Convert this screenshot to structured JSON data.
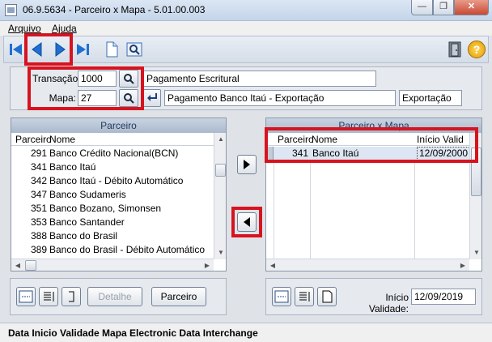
{
  "window": {
    "title": "06.9.5634 - Parceiro x Mapa - 5.01.00.003",
    "minimize_label": "—",
    "maximize_label": "❐",
    "close_label": "✕"
  },
  "menu": {
    "items": [
      "Arquivo",
      "Ajuda"
    ]
  },
  "toolbar": {
    "icons": [
      "first-record-icon",
      "previous-record-icon",
      "next-record-icon",
      "last-record-icon",
      "new-document-icon",
      "search-screen-icon",
      "exit-door-icon",
      "help-icon"
    ],
    "help_label": "?"
  },
  "form": {
    "transacao": {
      "label": "Transação:",
      "code": "1000",
      "description": "Pagamento Escritural"
    },
    "mapa": {
      "label": "Mapa:",
      "code": "27",
      "description": "Pagamento Banco Itaú - Exportação",
      "type": "Exportação"
    }
  },
  "left_grid": {
    "title": "Parceiro",
    "columns": [
      "Parceiro",
      "Nome"
    ],
    "rows": [
      {
        "code": "291",
        "name": "Banco Crédito Nacional(BCN)"
      },
      {
        "code": "341",
        "name": "Banco Itaú"
      },
      {
        "code": "342",
        "name": "Banco Itaú - Débito Automático"
      },
      {
        "code": "347",
        "name": "Banco Sudameris"
      },
      {
        "code": "351",
        "name": "Banco Bozano, Simonsen"
      },
      {
        "code": "353",
        "name": "Banco Santander"
      },
      {
        "code": "388",
        "name": "Banco do Brasil"
      },
      {
        "code": "389",
        "name": "Banco do Brasil - Débito Automático"
      }
    ]
  },
  "right_grid": {
    "title": "Parceiro x Mapa",
    "columns": [
      "Parceiro",
      "Nome",
      "Início Valid"
    ],
    "rows": [
      {
        "code": "341",
        "name": "Banco Itaú",
        "date": "12/09/2000"
      }
    ]
  },
  "left_buttons": {
    "detail": "Detalhe",
    "partner": "Parceiro"
  },
  "right_footer": {
    "label": "Início Validade:",
    "value": "12/09/2019"
  },
  "status": "Data Inicio Validade Mapa Electronic Data Interchange",
  "colors": {
    "highlight": "#d7131f",
    "nav_blue": "#1f6fd1"
  }
}
